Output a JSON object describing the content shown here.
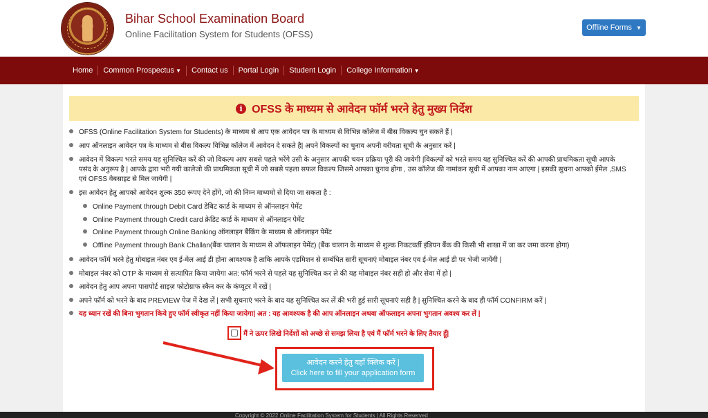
{
  "header": {
    "title": "Bihar School Examination Board",
    "subtitle": "Online Facilitation System for Students (OFSS)",
    "offline_forms": "Offline Forms",
    "logo": "bseb-seal-logo"
  },
  "nav": {
    "items": [
      {
        "label": "Home"
      },
      {
        "label": "Common Prospectus"
      },
      {
        "label": "Contact us"
      },
      {
        "label": "Portal Login"
      },
      {
        "label": "Student Login"
      },
      {
        "label": "College Information"
      }
    ]
  },
  "notice": {
    "title": "OFSS के माध्यम से आवेदन फॉर्म भरने हेतु मुख्य निर्देश",
    "icon": "info-circle-icon"
  },
  "instructions": [
    "OFSS (Online Facilitation System for Students) के माध्यम से आप एक आवेदन पत्र के माध्यम से विभिन्न कॉलेज में बीस विकल्प चुन सकते हैं |",
    "आप ऑनलाइन आवेदन पत्र के माध्यम से बीस विकल्प विभिन्न कॉलेज में आवेदन दे सकते है| अपने विकल्पों का चुनाव अपनी वरीयता सूची के अनुसार करें |",
    "आवेदन में विकल्प भरते समय यह सुनिश्चित करें की जो विकल्प आप सबसे पहले भरेंगे उसी के अनुसार आपकी चयन प्रक्रिया पूरी की जायेगी |विकल्पों को भरते समय यह सुनिश्चित करें की आपकी प्राथमिकता सूची आपके",
    "पसंद के अनुरूप है | आपके द्वारा भरी गयी कालेजो की प्राथमिकता सूची में जो सबसे पहला सफल विकल्प जिसमे आपका चुनाव होगा , उस कॉलेज की नामांकन सूची में आपका नाम आएगा | इसकी सुचना आपको ईमेल ,SMS",
    "एवं OFSS वेबसाइट से मिल जायेगी |",
    "इस आवेदन हेतु आपको आवेदन शुल्क 350 रूपए देने होंगे, जो की निम्न माध्यमो से दिया जा सकता है :",
    "Online Payment through Debit Card डेबिट कार्ड के माध्यम से ऑनलाइन पेमेंट",
    "Online Payment through Credit card क्रेडिट कार्ड के माध्यम से ऑनलाइन पेमेंट",
    "Online Payment through Online Banking ऑनलाइन बैंकिंग के माध्यम से ऑनलाइन पेमेंट",
    "Offline Payment through Bank Challan(बैंक चालान के माध्यम से ऑफलाइन पेमेंट) (बैंक चालान के माध्यम से शुल्क निकटवर्ती इंडियन बैंक की किसी भी शाखा में जा कर जमा करना होगा)",
    "आवेदन फॉर्म भरने हेतु मोबाइल नंबर एव ई-मेल आई डी होना आवश्यक है ताकि आपके एडमिशन से सम्बंधित सारी सूचनाएं मोबाइल नंबर एव ई-मेल आई डी पर भेजी जायेंगी |",
    "मोबाइल नंबर को OTP के माध्यम से सत्यापित किया जायेगा अत: फॉर्म भरने से पहले यह सुनिश्चित कर ले की यह मोबाइल नंबर सही हो और सेवा में हो |",
    "आवेदन हेतु आप अपना पासपोर्ट साइज़ फोटोग्राफ स्कैन कर के कंप्यूटर में रखें |",
    "अपने फॉर्म को भरने के बाद PREVIEW पेज में देख लें | सभी सूचनाएं भरने के बाद यह सुनिश्चित कर लें की भरी हुई सारी सूचनाएं सही है | सुनिश्चित करने के बाद ही फॉर्म CONFIRM करें |",
    "यह ध्यान रखें की बिना भुगतान किये हुए फॉर्म स्वीकृत नहीं किया जायेगा| अत : यह आवश्यक है की आप ऑनलाइन अथवा ऑफलाइन अपना भुगतान अवश्य कर लें |"
  ],
  "agree": {
    "label": "मैं ने ऊपर लिखे निर्देशों को अच्छे से समझ लिया है एवं मैं फॉर्म भरने के लिए तैयार हूँ|",
    "checked": false
  },
  "apply": {
    "line1": "आवेदन करने हेतु यहाँ क्लिक करें |",
    "line2": "Click here to fill your application form"
  },
  "footer": {
    "text": "Copyright © 2022 Online Facilitation System for Students | All Rights Reserved"
  },
  "colors": {
    "brand_red": "#7d0b0b",
    "title_red": "#8c1414",
    "notice_bg": "#fbeaa7",
    "alert_red": "#d0141a",
    "highlight": "#e0231a",
    "button_blue": "#2f79c3",
    "apply_button": "#5bc0de"
  }
}
